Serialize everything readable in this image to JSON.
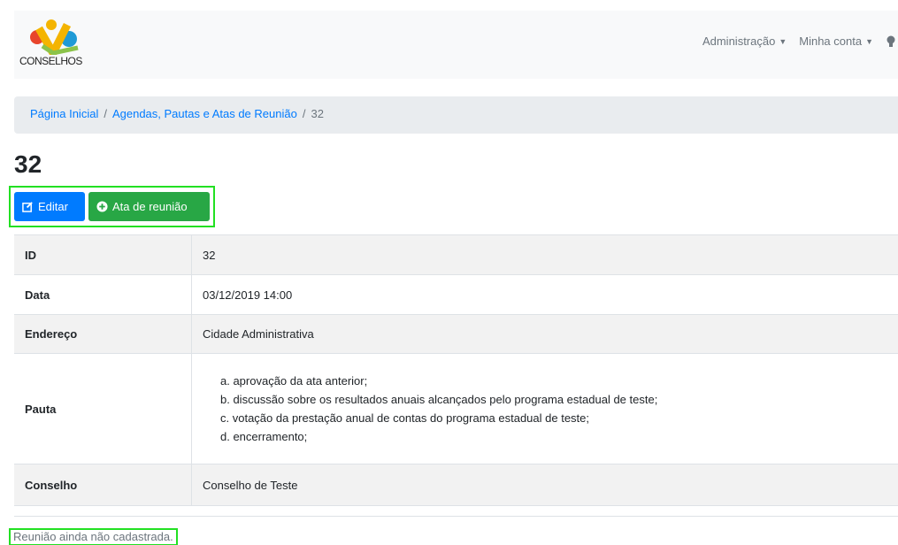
{
  "navbar": {
    "brand_text": "CONSELHOS",
    "items": [
      {
        "label": "Administração"
      },
      {
        "label": "Minha conta"
      }
    ]
  },
  "breadcrumb": {
    "items": [
      "Página Inicial",
      "Agendas, Pautas e Atas de Reunião"
    ],
    "current": "32"
  },
  "page": {
    "title": "32"
  },
  "actions": {
    "edit_label": "Editar",
    "ata_label": "Ata de reunião"
  },
  "details": {
    "rows": [
      {
        "label": "ID",
        "value": "32"
      },
      {
        "label": "Data",
        "value": "03/12/2019 14:00"
      },
      {
        "label": "Endereço",
        "value": "Cidade Administrativa"
      },
      {
        "label": "Pauta",
        "items": [
          "a. aprovação da ata anterior;",
          "b. discussão sobre os resultados anuais alcançados pelo programa estadual de teste;",
          "c. votação da prestação anual de contas do programa estadual de teste;",
          "d. encerramento;"
        ]
      },
      {
        "label": "Conselho",
        "value": "Conselho de Teste"
      }
    ]
  },
  "footer": {
    "notice": "Reunião ainda não cadastrada."
  },
  "colors": {
    "primary": "#007bff",
    "success": "#28a745",
    "highlight": "#22e022"
  }
}
